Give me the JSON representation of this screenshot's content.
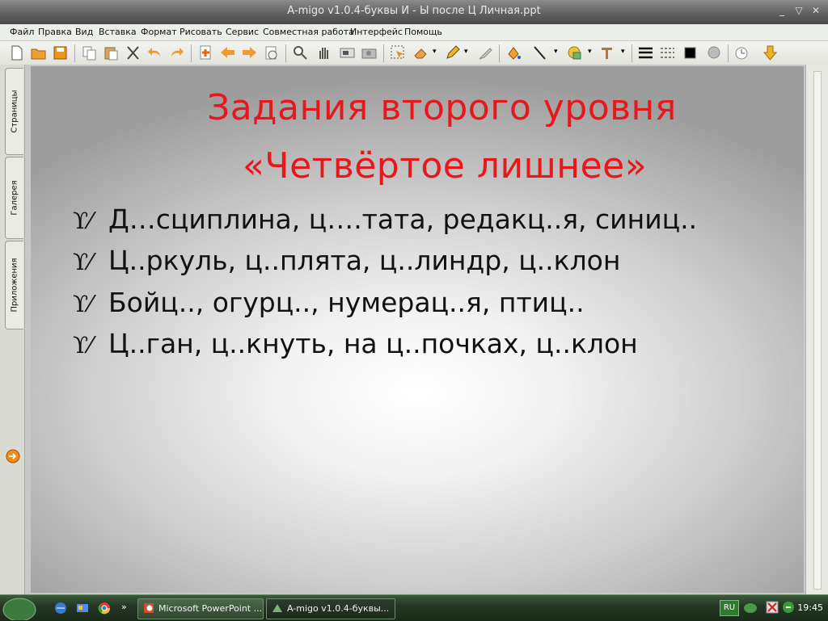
{
  "window": {
    "title": "A-migo v1.0.4-буквы И - Ы  после Ц Личная.ppt"
  },
  "menu": [
    "Файл",
    "Правка",
    "Вид",
    "Вставка",
    "Формат",
    "Рисовать",
    "Сервис",
    "Совместная работа",
    "Интерфейс",
    "Помощь"
  ],
  "toolbar": {
    "icons": [
      "new-document-icon",
      "open-folder-icon",
      "save-icon",
      "copy-icon",
      "paste-icon",
      "cut-icon",
      "undo-icon",
      "redo-icon",
      "add-page-icon",
      "previous-page-icon",
      "next-page-icon",
      "slideshow-icon",
      "zoom-icon",
      "hand-icon",
      "screen-capture-icon",
      "camera-icon",
      "select-icon",
      "eraser-icon",
      "pencil-icon",
      "highlighter-icon",
      "fill-icon",
      "line-icon",
      "shape-icon",
      "text-icon",
      "line-width-icon",
      "line-style-icon",
      "color-icon",
      "transparency-icon",
      "clock-icon",
      "down-arrow-icon"
    ]
  },
  "left_tabs": [
    "Страницы",
    "Галерея",
    "Приложения"
  ],
  "slide": {
    "heading_line1": "Задания второго уровня",
    "heading_line2": "«Четвёртое лишнее»",
    "bullet_marker": "ϒ⁄",
    "bullets": [
      "Д…сциплина, ц….тата, редакц..я, синиц..",
      "Ц..ркуль, ц..плята, ц..линдр, ц..клон",
      "Бойц.., огурц.., нумерац..я, птиц..",
      "Ц..ган, ц..кнуть, на ц..почках, ц..клон"
    ],
    "heading_color": "#e8171b"
  },
  "taskbar": {
    "tasks": [
      "Microsoft PowerPoint ...",
      "A-migo v1.0.4-буквы..."
    ],
    "lang": "RU",
    "clock": "19:45"
  }
}
